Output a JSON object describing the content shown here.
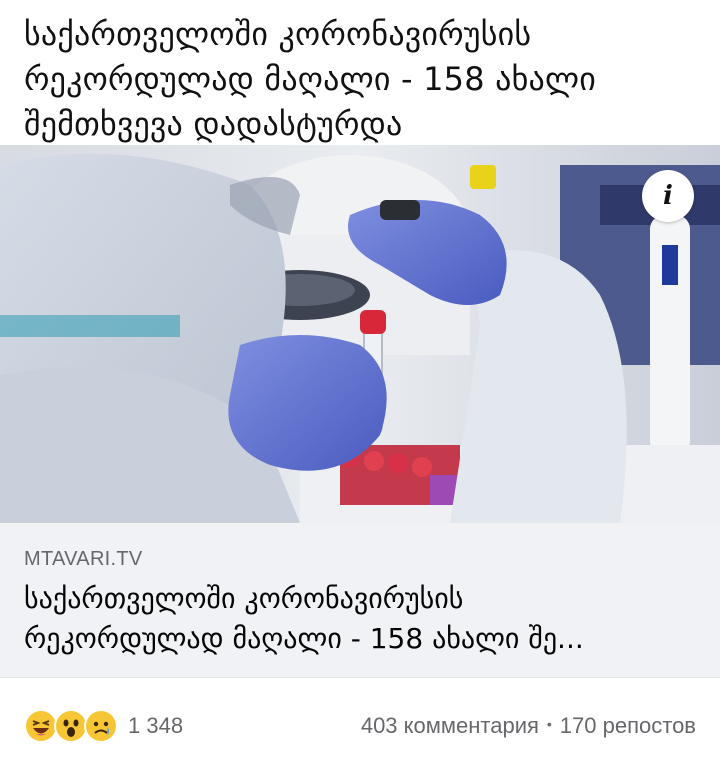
{
  "post": {
    "text_lines": [
      "საქართველოში კორონავირუსის",
      "რეკორდულად მაღალი - 158 ახალი",
      "შემთხვევა დადასტურდა"
    ]
  },
  "media": {
    "info_icon": "i"
  },
  "link_preview": {
    "domain": "MTAVARI.TV",
    "title_lines": [
      "საქართველოში კორონავირუსის",
      "რეკორდულად მაღალი - 158 ახალი შე..."
    ]
  },
  "stats": {
    "reactions": [
      "laughing-emoji",
      "surprised-emoji",
      "sad-emoji"
    ],
    "reaction_count": "1 348",
    "comments": "403 комментария",
    "separator": "•",
    "shares": "170 репостов"
  }
}
